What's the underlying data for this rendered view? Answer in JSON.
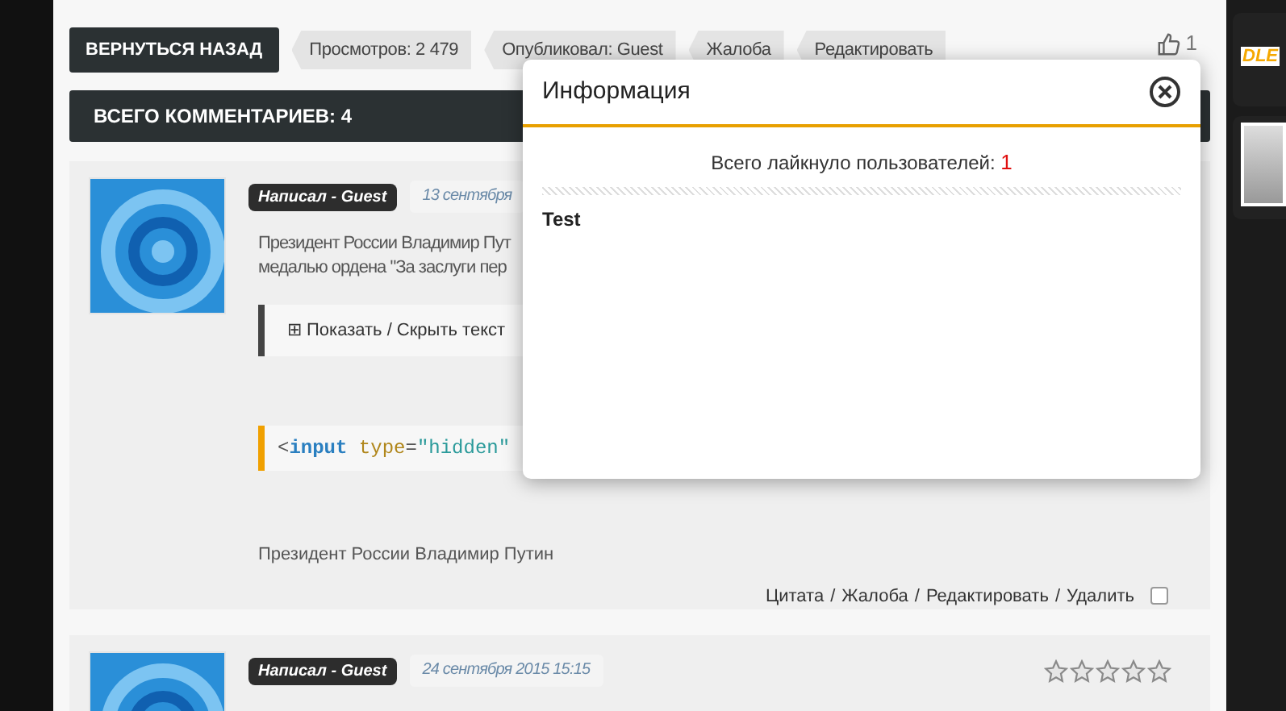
{
  "toolbar": {
    "back_button": "ВЕРНУТЬСЯ НАЗАД",
    "tags": [
      "Просмотров: 2 479",
      "Опубликовал: Guest",
      "Жалоба",
      "Редактировать"
    ],
    "likes": "1"
  },
  "comments_header": "ВСЕГО КОММЕНТАРИЕВ: 4",
  "comments": [
    {
      "author": "Написал - Guest",
      "date": "13 сентября",
      "text_lines": [
        "Президент России Владимир Пут",
        "медалью ордена \"За заслуги пер"
      ],
      "spoiler": "Показать / Скрыть текст",
      "spoiler_sign": "⊞",
      "code": [
        {
          "kind": "punct",
          "text": "<"
        },
        {
          "kind": "tag",
          "text": "input"
        },
        {
          "kind": "attr",
          "text": " type"
        },
        {
          "kind": "punct",
          "text": "="
        },
        {
          "kind": "string",
          "text": "\"hidden\""
        }
      ],
      "signature": "Президент России Владимир Путин",
      "actions": [
        "Цитата",
        "Жалоба",
        "Редактировать",
        "Удалить"
      ],
      "separator": "/",
      "checked": false
    },
    {
      "author": "Написал - Guest",
      "date": "24 сентября 2015 15:15",
      "stars": 0
    }
  ],
  "sidebar": {
    "logo": "DLE"
  },
  "modal": {
    "title": "Информация",
    "summary": "Всего лайкнуло пользователей:",
    "count": "1",
    "users": [
      "Test"
    ]
  }
}
